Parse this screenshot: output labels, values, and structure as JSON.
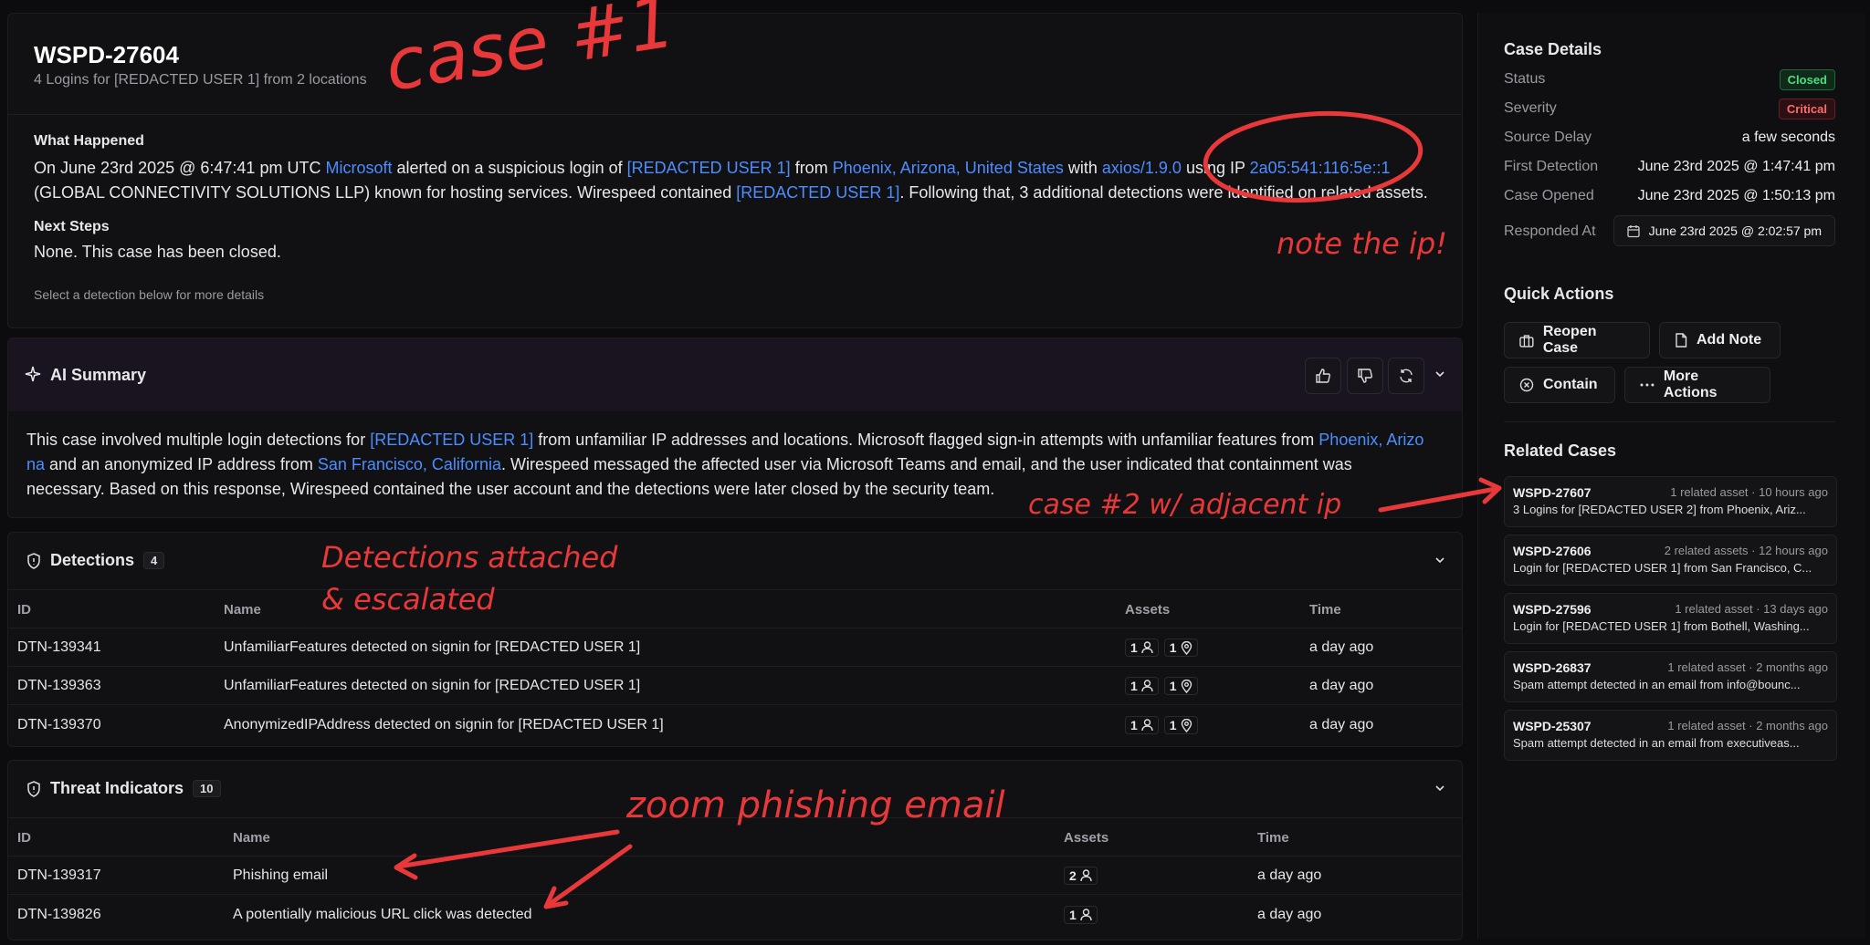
{
  "case": {
    "id": "WSPD-27604",
    "subtitle": "4 Logins for [REDACTED USER 1] from 2 locations",
    "what_happened_label": "What Happened",
    "what_happened": {
      "p1": "On June 23rd 2025 @ 6:47:41 pm UTC ",
      "l1": "Microsoft",
      "p2": " alerted on a suspicious login of ",
      "l2": "[REDACTED USER 1]",
      "p3": " from ",
      "l3": "Phoenix, Arizona, United States",
      "p4": " with ",
      "l4": "axios/1.9.0",
      "p5": " using IP ",
      "l5": "2a05:541:116:5e::1",
      "p6": "(GLOBAL CONNECTIVITY SOLUTIONS LLP) known for hosting services. Wirespeed contained ",
      "l6": "[REDACTED USER 1]",
      "p7": ". Following that, 3 additional detections were identified on related assets."
    },
    "next_steps_label": "Next Steps",
    "next_steps": "None. This case has been closed.",
    "hint": "Select a detection below for more details"
  },
  "ai_summary": {
    "title": "AI Summary",
    "p1": "This case involved multiple login detections for ",
    "l1": "[REDACTED USER 1]",
    "p2": " from unfamiliar IP addresses and locations. Microsoft flagged sign-in attempts with unfamiliar features from ",
    "l2": "Phoenix, Arizo",
    "l2b": "na",
    "p3": " and an anonymized IP address from ",
    "l3": "San Francisco, California",
    "p4": ". Wirespeed messaged the affected user via Microsoft Teams and email, and the user indicated that containment was",
    "p5": "necessary. Based on this response, Wirespeed contained the user account and the detections were later closed by the security team."
  },
  "detections": {
    "title": "Detections",
    "count": "4",
    "headers": {
      "id": "ID",
      "name": "Name",
      "assets": "Assets",
      "time": "Time"
    },
    "rows": [
      {
        "id": "DTN-139341",
        "name": "UnfamiliarFeatures detected on signin for [REDACTED USER 1]",
        "users": "1",
        "locs": "1",
        "time": "a day ago"
      },
      {
        "id": "DTN-139363",
        "name": "UnfamiliarFeatures detected on signin for [REDACTED USER 1]",
        "users": "1",
        "locs": "1",
        "time": "a day ago"
      },
      {
        "id": "DTN-139370",
        "name": "AnonymizedIPAddress detected on signin for [REDACTED USER 1]",
        "users": "1",
        "locs": "1",
        "time": "a day ago"
      }
    ]
  },
  "threats": {
    "title": "Threat Indicators",
    "count": "10",
    "headers": {
      "id": "ID",
      "name": "Name",
      "assets": "Assets",
      "time": "Time"
    },
    "rows": [
      {
        "id": "DTN-139317",
        "name": "Phishing email",
        "users": "2",
        "time": "a day ago"
      },
      {
        "id": "DTN-139826",
        "name": "A potentially malicious URL click was detected",
        "users": "1",
        "time": "a day ago"
      }
    ]
  },
  "details": {
    "title": "Case Details",
    "status_label": "Status",
    "status": "Closed",
    "severity_label": "Severity",
    "severity": "Critical",
    "delay_label": "Source Delay",
    "delay": "a few seconds",
    "first_label": "First Detection",
    "first": "June 23rd 2025 @ 1:47:41 pm",
    "opened_label": "Case Opened",
    "opened": "June 23rd 2025 @ 1:50:13 pm",
    "responded_label": "Responded At",
    "responded": "June 23rd 2025 @ 2:02:57 pm"
  },
  "quick_actions": {
    "title": "Quick Actions",
    "reopen": "Reopen Case",
    "add_note": "Add Note",
    "contain": "Contain",
    "more": "More Actions"
  },
  "related": {
    "title": "Related Cases",
    "items": [
      {
        "id": "WSPD-27607",
        "meta": "1 related asset · 10 hours ago",
        "desc": "3 Logins for [REDACTED USER 2] from Phoenix, Ariz..."
      },
      {
        "id": "WSPD-27606",
        "meta": "2 related assets · 12 hours ago",
        "desc": "Login for [REDACTED USER 1] from San Francisco, C..."
      },
      {
        "id": "WSPD-27596",
        "meta": "1 related asset · 13 days ago",
        "desc": "Login for [REDACTED USER 1] from Bothell, Washing..."
      },
      {
        "id": "WSPD-26837",
        "meta": "1 related asset · 2 months ago",
        "desc": "Spam attempt detected in an email from info@bounc..."
      },
      {
        "id": "WSPD-25307",
        "meta": "1 related asset · 2 months ago",
        "desc": "Spam attempt detected in an email from executiveas..."
      }
    ]
  },
  "annotations": {
    "case1": "case #1",
    "note_ip": "note the ip!",
    "case2": "case #2 w/ adjacent ip",
    "detections_line1": "Detections attached",
    "detections_line2": "& escalated",
    "zoom": "zoom phishing email"
  },
  "colors": {
    "accent": "#4c8dff",
    "closed": "#4ade80",
    "critical": "#ff6b6b",
    "annotation": "#e8383a"
  }
}
